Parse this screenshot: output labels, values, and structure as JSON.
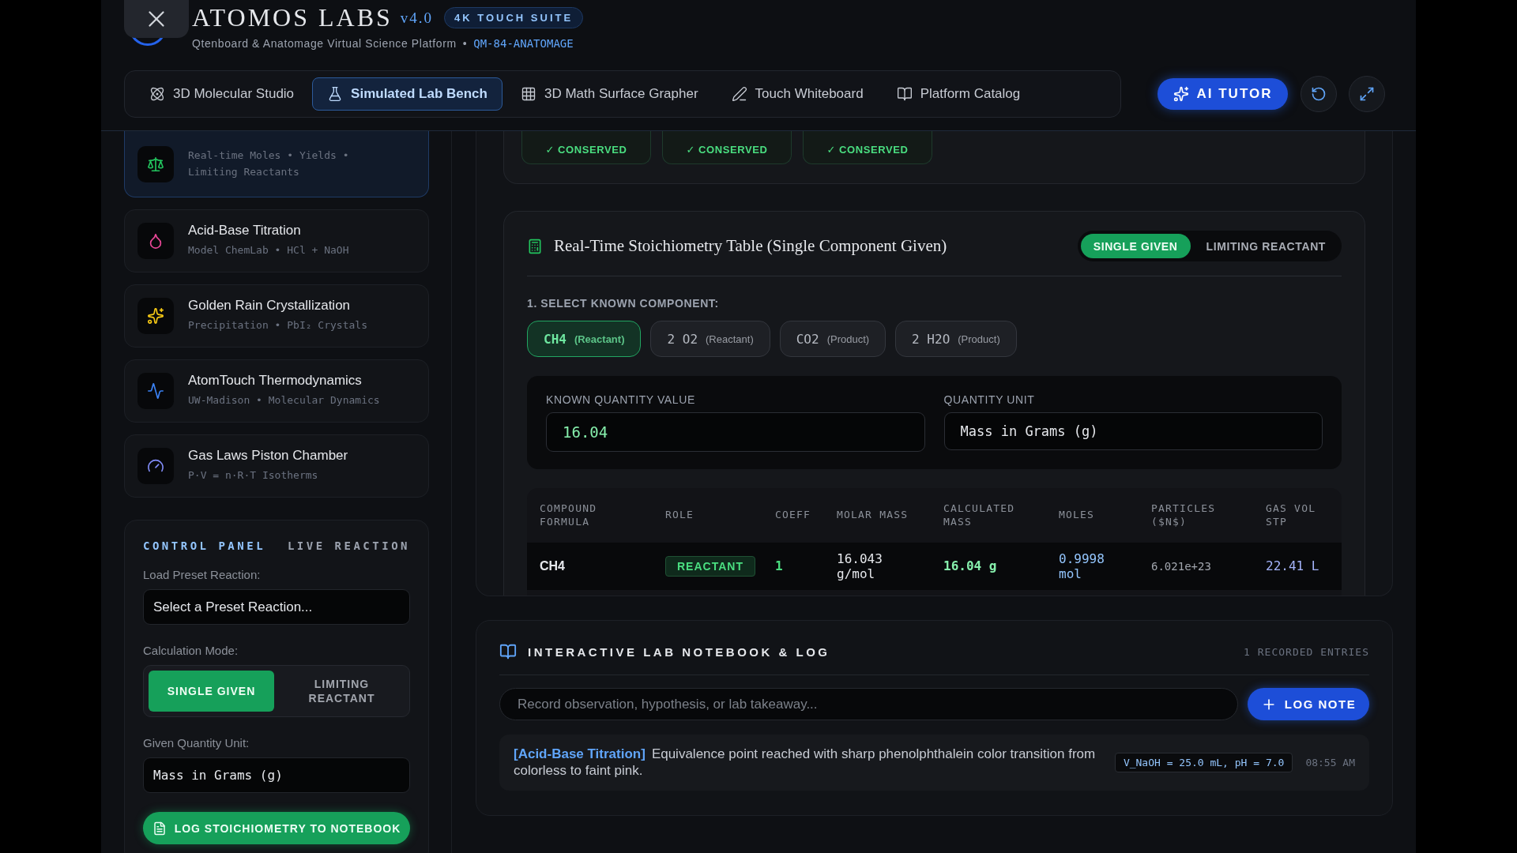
{
  "header": {
    "title": "ATOMOS LABS",
    "version": "v4.0",
    "badge": "4K TOUCH SUITE",
    "subtitle": "Qtenboard & Anatomage Virtual Science Platform",
    "separator": "•",
    "code": "QM-84-ANATOMAGE"
  },
  "nav_tabs": [
    {
      "label": "3D Molecular Studio",
      "selected": false
    },
    {
      "label": "Simulated Lab Bench",
      "selected": true
    },
    {
      "label": "3D Math Surface Grapher",
      "selected": false
    },
    {
      "label": "Touch Whiteboard",
      "selected": false
    },
    {
      "label": "Platform Catalog",
      "selected": false
    }
  ],
  "ai_tutor": "AI TUTOR",
  "sidebar": {
    "modules": [
      {
        "subtitle": "Real-time Moles • Yields • Limiting Reactants",
        "color": "#22c55e",
        "selected": true
      },
      {
        "title": "Acid-Base Titration",
        "subtitle": "Model ChemLab • HCl + NaOH",
        "color": "#ec4899",
        "selected": false
      },
      {
        "title": "Golden Rain Crystallization",
        "subtitle": "Precipitation • PbI₂ Crystals",
        "color": "#facc15",
        "selected": false
      },
      {
        "title": "AtomTouch Thermodynamics",
        "subtitle": "UW-Madison • Molecular Dynamics",
        "color": "#3b82f6",
        "selected": false
      },
      {
        "title": "Gas Laws Piston Chamber",
        "subtitle": "P·V = n·R·T Isotherms",
        "color": "#818cf8",
        "selected": false
      }
    ],
    "control_panel": {
      "tabs": [
        {
          "label": "CONTROL PANEL",
          "selected": true
        },
        {
          "label": "LIVE REACTION",
          "selected": false
        }
      ],
      "preset_label": "Load Preset Reaction:",
      "preset_value": "Select a Preset Reaction...",
      "mode_label": "Calculation Mode:",
      "modes": [
        {
          "label": "SINGLE GIVEN",
          "selected": true
        },
        {
          "label": "LIMITING REACTANT",
          "selected": false
        }
      ],
      "unit_label": "Given Quantity Unit:",
      "unit_value": "Mass in Grams (g)",
      "log_button": "LOG STOICHIOMETRY TO NOTEBOOK"
    }
  },
  "conservation": [
    "✓ CONSERVED",
    "✓ CONSERVED",
    "✓ CONSERVED"
  ],
  "stoichiometry": {
    "title": "Real-Time Stoichiometry Table (Single Component Given)",
    "mode_toggle": [
      {
        "label": "SINGLE GIVEN",
        "selected": true
      },
      {
        "label": "LIMITING REACTANT",
        "selected": false
      }
    ],
    "select_label": "1. SELECT KNOWN COMPONENT:",
    "components": [
      {
        "formula": "CH4",
        "role": "(Reactant)",
        "selected": true
      },
      {
        "formula": "2 O2",
        "role": "(Reactant)",
        "selected": false
      },
      {
        "formula": "CO2",
        "role": "(Product)",
        "selected": false
      },
      {
        "formula": "2 H2O",
        "role": "(Product)",
        "selected": false
      }
    ],
    "known_value_label": "KNOWN QUANTITY VALUE",
    "known_value": "16.04",
    "unit_label": "QUANTITY UNIT",
    "unit_value": "Mass in Grams (g)",
    "table": {
      "columns": [
        "COMPOUND FORMULA",
        "ROLE",
        "COEFF",
        "MOLAR MASS",
        "CALCULATED MASS",
        "MOLES",
        "PARTICLES ($N$)",
        "GAS VOL STP"
      ],
      "rows": [
        {
          "formula": "CH4",
          "role": "REACTANT",
          "coeff": "1",
          "molar_mass": "16.043 g/mol",
          "mass": "16.04 g",
          "moles": "0.9998 mol",
          "particles": "6.021e+23",
          "gas_volume": "22.41 L"
        }
      ]
    }
  },
  "notebook": {
    "title": "INTERACTIVE LAB NOTEBOOK & LOG",
    "count": "1 RECORDED ENTRIES",
    "placeholder": "Record observation, hypothesis, or lab takeaway...",
    "button": "LOG NOTE",
    "entries": [
      {
        "tag": "[Acid-Base Titration]",
        "text": "Equivalence point reached with sharp phenolphthalein color transition from colorless to faint pink.",
        "data": "V_NaOH = 25.0 mL, pH = 7.0",
        "time": "08:55 AM"
      }
    ]
  }
}
